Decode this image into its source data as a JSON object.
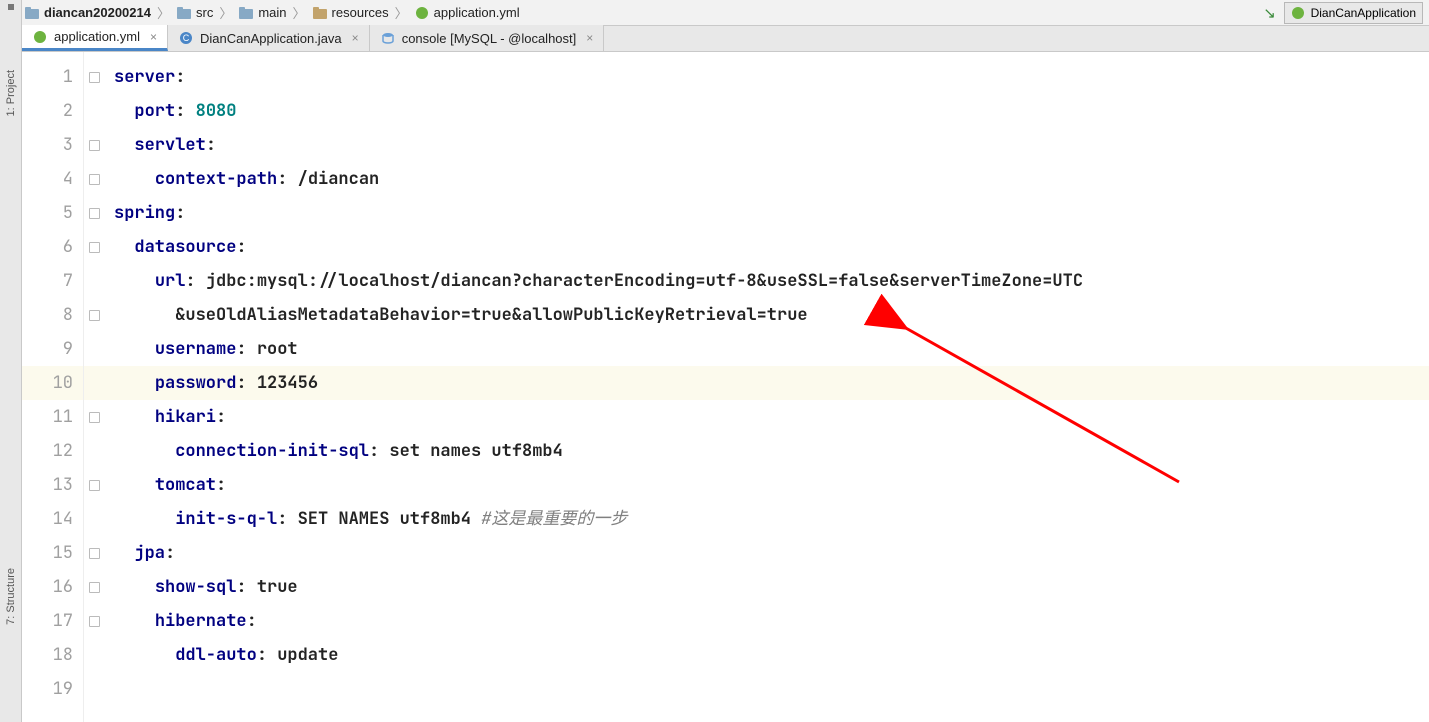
{
  "breadcrumb": {
    "project": "diancan20200214",
    "src": "src",
    "main": "main",
    "resources": "resources",
    "file": "application.yml"
  },
  "run_config": "DianCanApplication",
  "tabs": [
    {
      "label": "application.yml",
      "icon": "spring"
    },
    {
      "label": "DianCanApplication.java",
      "icon": "java"
    },
    {
      "label": "console [MySQL - @localhost]",
      "icon": "db"
    }
  ],
  "left_labels": {
    "project": "1: Project",
    "structure": "7: Structure"
  },
  "code_lines": [
    {
      "n": 1,
      "hl": false,
      "tokens": [
        {
          "t": "server",
          "c": "key"
        },
        {
          "t": ":",
          "c": "plain"
        }
      ]
    },
    {
      "n": 2,
      "hl": false,
      "tokens": [
        {
          "t": "  ",
          "c": "plain"
        },
        {
          "t": "port",
          "c": "key"
        },
        {
          "t": ": ",
          "c": "plain"
        },
        {
          "t": "8080",
          "c": "val"
        }
      ]
    },
    {
      "n": 3,
      "hl": false,
      "tokens": [
        {
          "t": "  ",
          "c": "plain"
        },
        {
          "t": "servlet",
          "c": "key"
        },
        {
          "t": ":",
          "c": "plain"
        }
      ]
    },
    {
      "n": 4,
      "hl": false,
      "tokens": [
        {
          "t": "    ",
          "c": "plain"
        },
        {
          "t": "context-path",
          "c": "key"
        },
        {
          "t": ": /diancan",
          "c": "plain"
        }
      ]
    },
    {
      "n": 5,
      "hl": false,
      "tokens": [
        {
          "t": "spring",
          "c": "key"
        },
        {
          "t": ":",
          "c": "plain"
        }
      ]
    },
    {
      "n": 6,
      "hl": false,
      "tokens": [
        {
          "t": "  ",
          "c": "plain"
        },
        {
          "t": "datasource",
          "c": "key"
        },
        {
          "t": ":",
          "c": "plain"
        }
      ]
    },
    {
      "n": 7,
      "hl": false,
      "tokens": [
        {
          "t": "    ",
          "c": "plain"
        },
        {
          "t": "url",
          "c": "key"
        },
        {
          "t": ": jdbc:mysql://localhost/diancan?characterEncoding=utf-8&useSSL=false&serverTimeZone=UTC",
          "c": "plain"
        }
      ]
    },
    {
      "n": 8,
      "hl": false,
      "tokens": [
        {
          "t": "      &useOldAliasMetadataBehavior=true&allowPublicKeyRetrieval=true",
          "c": "plain"
        }
      ]
    },
    {
      "n": 9,
      "hl": false,
      "tokens": [
        {
          "t": "    ",
          "c": "plain"
        },
        {
          "t": "username",
          "c": "key"
        },
        {
          "t": ": root",
          "c": "plain"
        }
      ]
    },
    {
      "n": 10,
      "hl": true,
      "tokens": [
        {
          "t": "    ",
          "c": "plain"
        },
        {
          "t": "password",
          "c": "key"
        },
        {
          "t": ": ",
          "c": "plain"
        },
        {
          "t": "123456",
          "c": "plain"
        }
      ]
    },
    {
      "n": 11,
      "hl": false,
      "tokens": [
        {
          "t": "    ",
          "c": "plain"
        },
        {
          "t": "hikari",
          "c": "key"
        },
        {
          "t": ":",
          "c": "plain"
        }
      ]
    },
    {
      "n": 12,
      "hl": false,
      "tokens": [
        {
          "t": "      ",
          "c": "plain"
        },
        {
          "t": "connection-init-sql",
          "c": "key"
        },
        {
          "t": ": set names utf8mb4",
          "c": "plain"
        }
      ]
    },
    {
      "n": 13,
      "hl": false,
      "tokens": [
        {
          "t": "    ",
          "c": "plain"
        },
        {
          "t": "tomcat",
          "c": "key"
        },
        {
          "t": ":",
          "c": "plain"
        }
      ]
    },
    {
      "n": 14,
      "hl": false,
      "tokens": [
        {
          "t": "      ",
          "c": "plain"
        },
        {
          "t": "init-s-q-l",
          "c": "key"
        },
        {
          "t": ": SET NAMES utf8mb4 ",
          "c": "plain"
        },
        {
          "t": "#这是最重要的一步",
          "c": "comment"
        }
      ]
    },
    {
      "n": 15,
      "hl": false,
      "tokens": [
        {
          "t": "  ",
          "c": "plain"
        },
        {
          "t": "jpa",
          "c": "key"
        },
        {
          "t": ":",
          "c": "plain"
        }
      ]
    },
    {
      "n": 16,
      "hl": false,
      "tokens": [
        {
          "t": "    ",
          "c": "plain"
        },
        {
          "t": "show-sql",
          "c": "key"
        },
        {
          "t": ": true",
          "c": "plain"
        }
      ]
    },
    {
      "n": 17,
      "hl": false,
      "tokens": [
        {
          "t": "    ",
          "c": "plain"
        },
        {
          "t": "hibernate",
          "c": "key"
        },
        {
          "t": ":",
          "c": "plain"
        }
      ]
    },
    {
      "n": 18,
      "hl": false,
      "tokens": [
        {
          "t": "      ",
          "c": "plain"
        },
        {
          "t": "ddl-auto",
          "c": "key"
        },
        {
          "t": ": update",
          "c": "plain"
        }
      ]
    },
    {
      "n": 19,
      "hl": false,
      "tokens": [
        {
          "t": "",
          "c": "plain"
        }
      ]
    }
  ]
}
